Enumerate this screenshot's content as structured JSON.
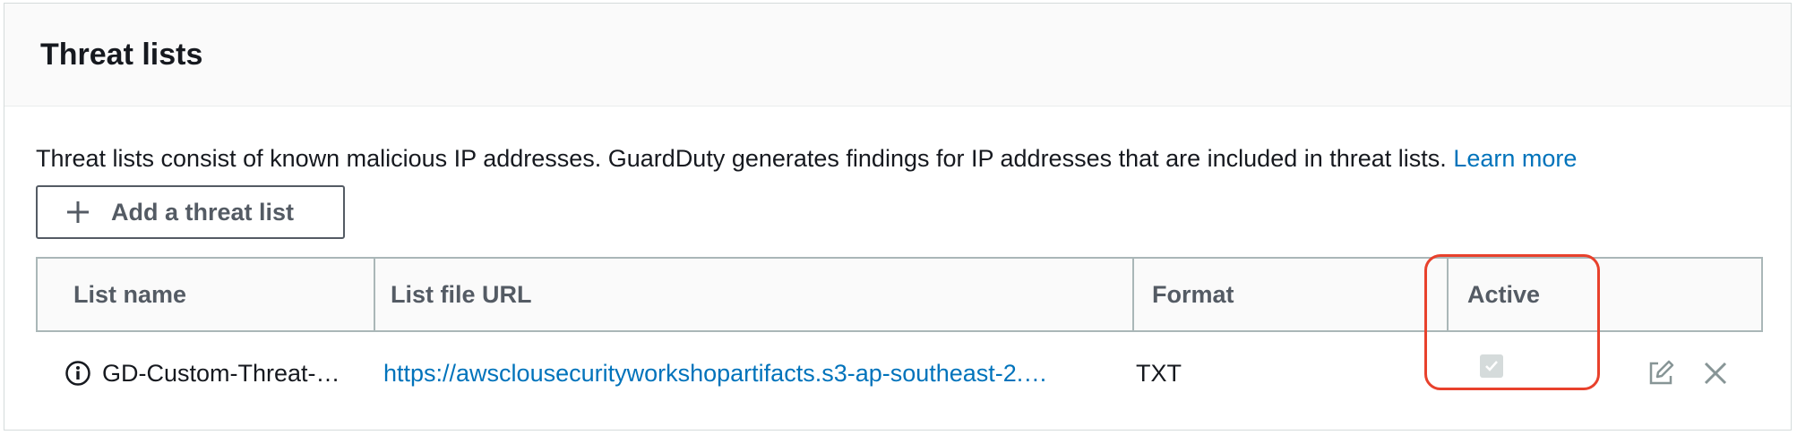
{
  "panel": {
    "title": "Threat lists",
    "description": "Threat lists consist of known malicious IP addresses. GuardDuty generates findings for IP addresses that are included in threat lists.",
    "learn_more": "Learn more",
    "add_button_label": "Add a threat list"
  },
  "table": {
    "columns": [
      "List name",
      "List file URL",
      "Format",
      "Active"
    ],
    "rows": [
      {
        "list_name": "GD-Custom-Threat-…",
        "list_file_url": "https://awsclousecurityworkshopartifacts.s3-ap-southeast-2.…",
        "format": "TXT",
        "active": true,
        "active_disabled": true
      }
    ]
  },
  "icons": {
    "add": "plus-icon",
    "info": "info-icon",
    "edit": "edit-icon",
    "delete": "close-icon"
  },
  "colors": {
    "link": "#0073bb",
    "highlight": "#e8412c",
    "header_bg": "#fafafa",
    "border": "#aab7b8"
  }
}
